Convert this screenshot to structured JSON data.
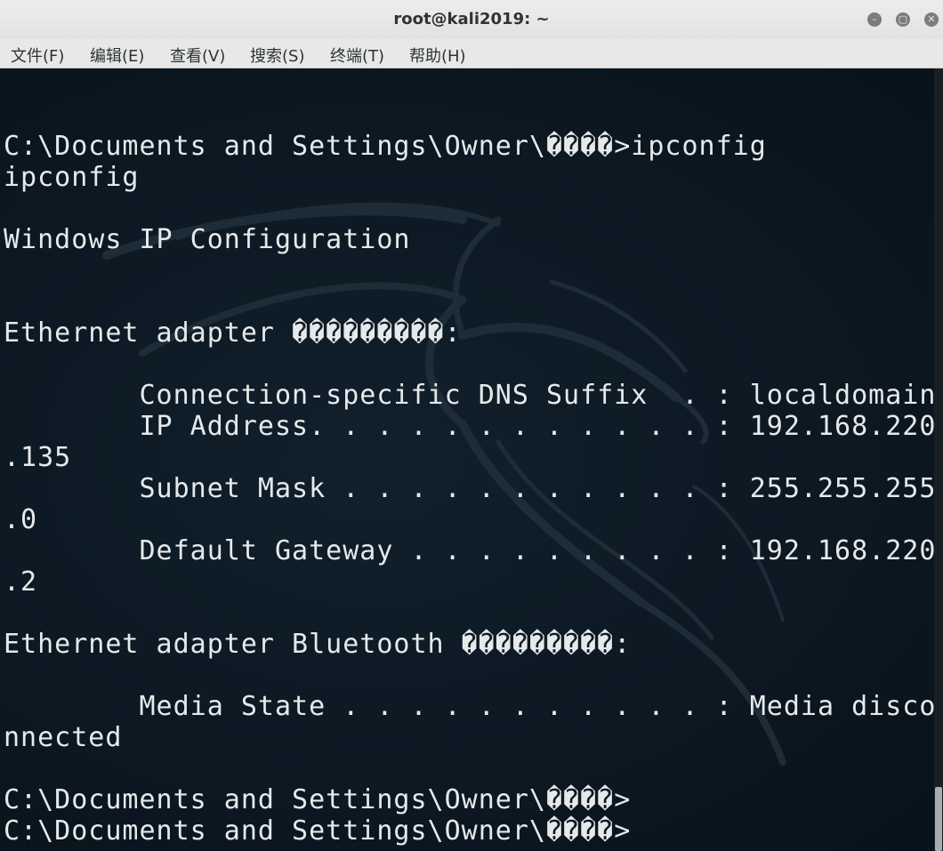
{
  "window": {
    "title": "root@kali2019: ~",
    "controls": {
      "minimize": "–",
      "maximize": "▢",
      "close": "✕"
    }
  },
  "menu": [
    "文件(F)",
    "编辑(E)",
    "查看(V)",
    "搜索(S)",
    "终端(T)",
    "帮助(H)"
  ],
  "terminal": {
    "lines": [
      "C:\\Documents and Settings\\Owner\\����>ipconfig",
      "ipconfig",
      "",
      "Windows IP Configuration",
      "",
      "",
      "Ethernet adapter ���������:",
      "",
      "        Connection-specific DNS Suffix  . : localdomain",
      "        IP Address. . . . . . . . . . . . : 192.168.220",
      ".135",
      "        Subnet Mask . . . . . . . . . . . : 255.255.255",
      ".0",
      "        Default Gateway . . . . . . . . . : 192.168.220",
      ".2",
      "",
      "Ethernet adapter Bluetooth ���������:",
      "",
      "        Media State . . . . . . . . . . . : Media disco",
      "nnected",
      "",
      "C:\\Documents and Settings\\Owner\\����>",
      "C:\\Documents and Settings\\Owner\\����>"
    ]
  }
}
